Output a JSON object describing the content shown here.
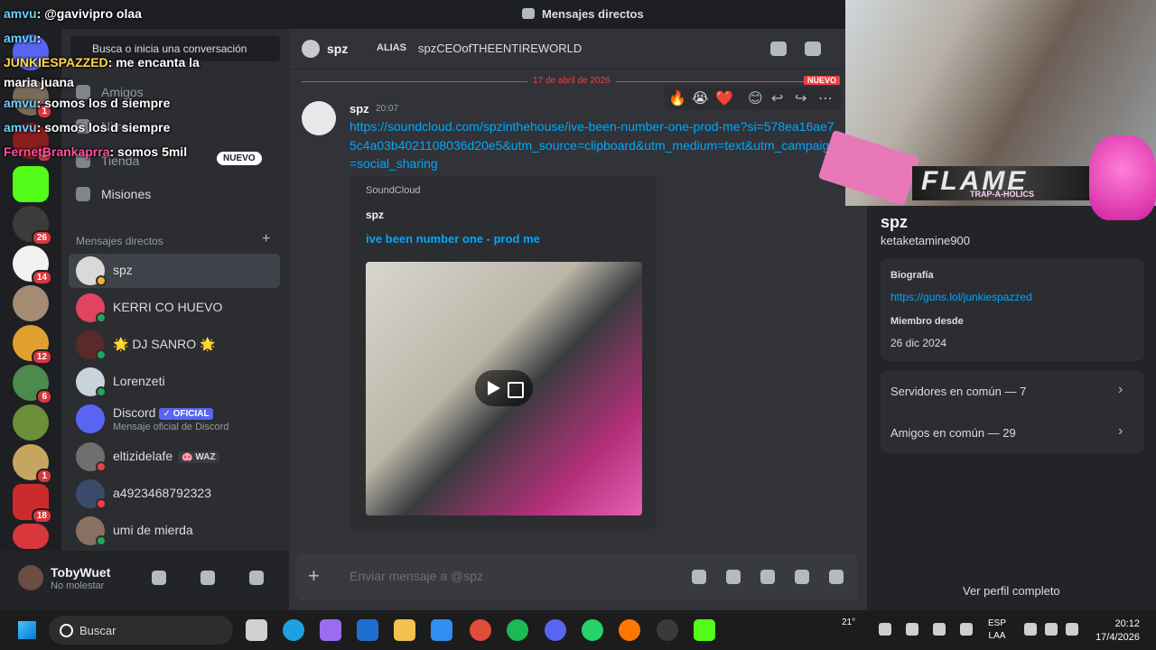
{
  "window": {
    "title": "Mensajes directos"
  },
  "colors": {
    "accent": "#5865f2",
    "link": "#00a8fc",
    "danger": "#f23f43",
    "online": "#23a55a",
    "dnd": "#f23f43",
    "idle": "#f0b232"
  },
  "servers": [
    {
      "name": "discord-home-icon",
      "badge": ""
    },
    {
      "name": "server-1",
      "badge": "1"
    },
    {
      "name": "server-2",
      "badge": "2"
    },
    {
      "name": "server-3",
      "badge": ""
    },
    {
      "name": "server-4",
      "badge": "26"
    },
    {
      "name": "server-5",
      "badge": "14"
    },
    {
      "name": "server-6",
      "badge": ""
    },
    {
      "name": "server-7",
      "badge": "12"
    },
    {
      "name": "server-8",
      "badge": "6"
    },
    {
      "name": "server-9",
      "badge": ""
    },
    {
      "name": "server-10",
      "badge": "1"
    },
    {
      "name": "server-11",
      "badge": "18"
    },
    {
      "name": "server-12",
      "badge": "7"
    }
  ],
  "sidebar": {
    "search_placeholder": "Busca o inicia una conversación",
    "nav": [
      {
        "label": "Amigos"
      },
      {
        "label": "Nitro"
      },
      {
        "label": "Tienda"
      },
      {
        "label": "Misiones"
      }
    ],
    "new_badge": "NUEVO",
    "dm_header": "Mensajes directos",
    "dms": [
      {
        "name": "spz",
        "sub": "",
        "tag": "",
        "status": "idle"
      },
      {
        "name": "KERRI CO HUEVO",
        "sub": "",
        "tag": "",
        "status": "online"
      },
      {
        "name": "🌟 DJ SANRO 🌟",
        "sub": "",
        "tag": "",
        "status": "online"
      },
      {
        "name": "Lorenzeti",
        "sub": "",
        "tag": "",
        "status": "online"
      },
      {
        "name": "Discord",
        "sub": "Mensaje oficial de Discord",
        "tag": "✓ OFICIAL",
        "status": ""
      },
      {
        "name": "eltizidelafe",
        "sub": "",
        "tag": "🐽 WAZ",
        "status": "dnd"
      },
      {
        "name": "a4923468792323",
        "sub": "",
        "tag": "",
        "status": "dnd"
      },
      {
        "name": "umi de mierda",
        "sub": "",
        "tag": "",
        "status": "online"
      }
    ]
  },
  "user": {
    "name": "TobyWuet",
    "status": "No molestar"
  },
  "chat_overlay": [
    {
      "user": "amvu",
      "text": ": @gavivipro olaa"
    },
    {
      "user": "amvu",
      "text": ":"
    },
    {
      "user": "JUNKIESPAZZED",
      "text": ": me encanta la"
    },
    {
      "user": "",
      "text": "maria juana"
    },
    {
      "user": "amvu",
      "text": ": somos los d siempre"
    },
    {
      "user": "amvu",
      "text": ": somos los d siempre"
    },
    {
      "user": "FernetBrankaprra",
      "text": ": somos 5mil"
    }
  ],
  "channel": {
    "name": "spz",
    "alias_label": "ALIAS",
    "alias_value": "spzCEOofTHEENTIREWORLD"
  },
  "divider": {
    "date": "17 de abril de 2026",
    "new": "NUEVO"
  },
  "message": {
    "author": "spz",
    "time": "20:07",
    "link": "https://soundcloud.com/spzinthehouse/ive-been-number-one-prod-me?si=578ea16ae75c4a03b4021108036d20e5&utm_source=clipboard&utm_medium=text&utm_campaign=social_sharing",
    "embed": {
      "provider": "SoundCloud",
      "author": "spz",
      "title": "ive been number one - prod me"
    }
  },
  "reactions": [
    "🔥",
    "😭",
    "❤️",
    "😊",
    "↩",
    "↪",
    "⋯"
  ],
  "composer": {
    "placeholder": "Enviar mensaje a @spz"
  },
  "profile": {
    "display_name": "spz",
    "username": "ketaketamine900",
    "bio_label": "Biografía",
    "bio_link": "https://guns.lol/junkiespazzed",
    "member_label": "Miembro desde",
    "member_since": "26 dic 2024",
    "mutual_servers": "Servidores en común — 7",
    "mutual_friends": "Amigos en común — 29",
    "full_profile": "Ver perfil completo"
  },
  "stream_overlay": {
    "title": "FLAME",
    "subtitle": "TRAP-A-HOLICS"
  },
  "taskbar": {
    "search": "Buscar",
    "weather": "21°",
    "lang_1": "ESP",
    "lang_2": "LAA",
    "time": "20:12",
    "date": "17/4/2026",
    "apps": [
      "file-explorer",
      "edge",
      "copilot",
      "outlook",
      "folder",
      "store",
      "chrome",
      "spotify",
      "discord",
      "whatsapp",
      "soundcloud",
      "obs",
      "kick"
    ]
  }
}
